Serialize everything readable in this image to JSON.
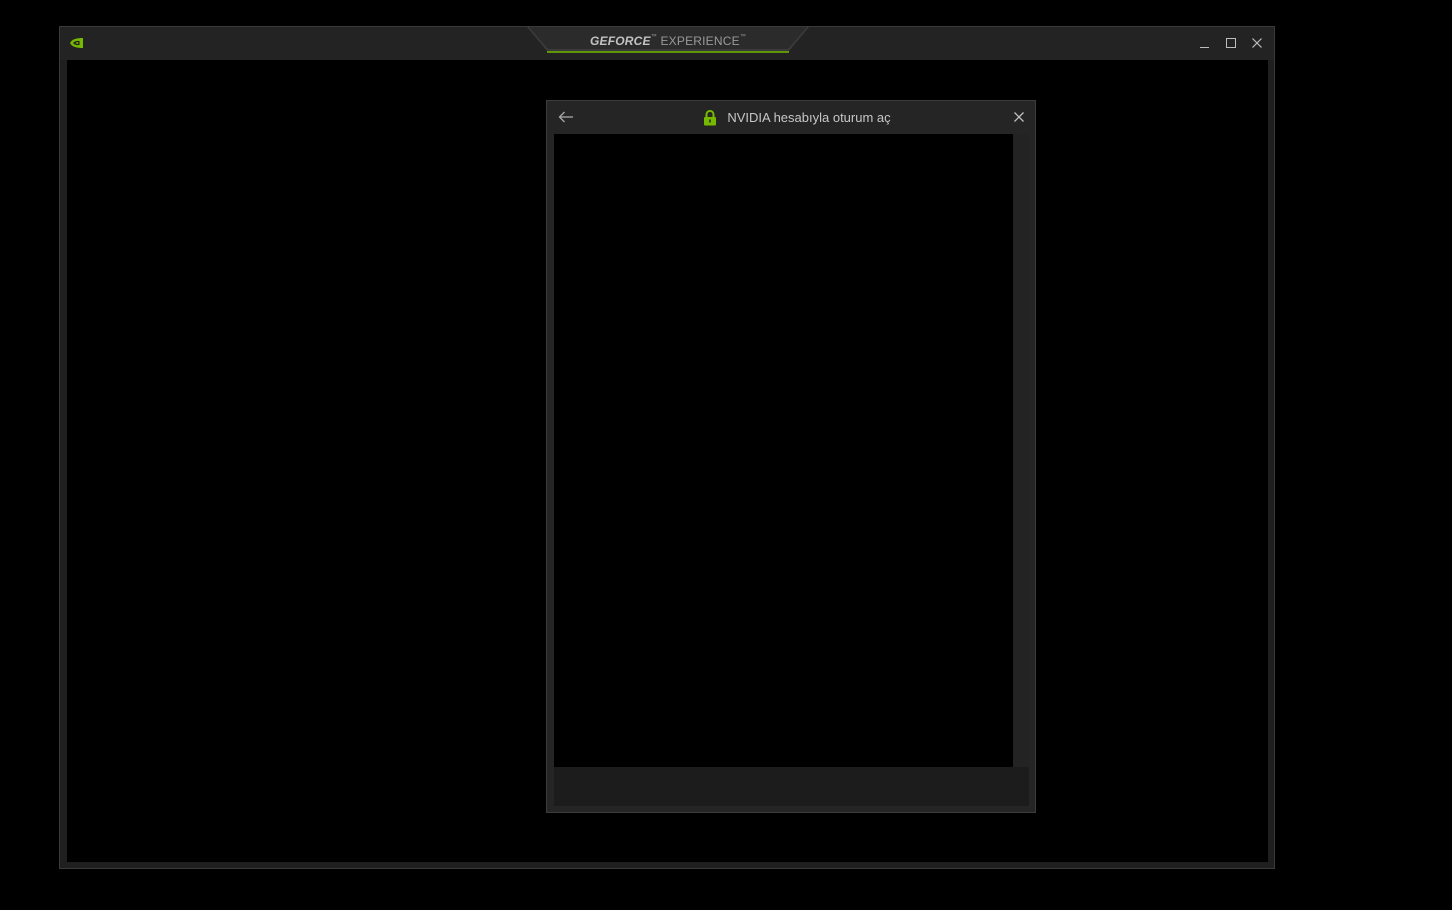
{
  "window": {
    "brand_primary": "GEFORCE",
    "brand_secondary": "EXPERIENCE",
    "logo_icon": "nvidia-logo-icon",
    "controls": {
      "minimize_icon": "minimize-icon",
      "maximize_icon": "maximize-icon",
      "close_icon": "close-icon"
    }
  },
  "dialog": {
    "title": "NVIDIA hesabıyla oturum aç",
    "back_icon": "arrow-left-icon",
    "lock_icon": "lock-icon",
    "close_icon": "close-icon"
  },
  "colors": {
    "accent": "#76b900",
    "window_bg": "#1f1f1f",
    "titlebar_bg": "#232323",
    "text": "#c6c6c6"
  }
}
